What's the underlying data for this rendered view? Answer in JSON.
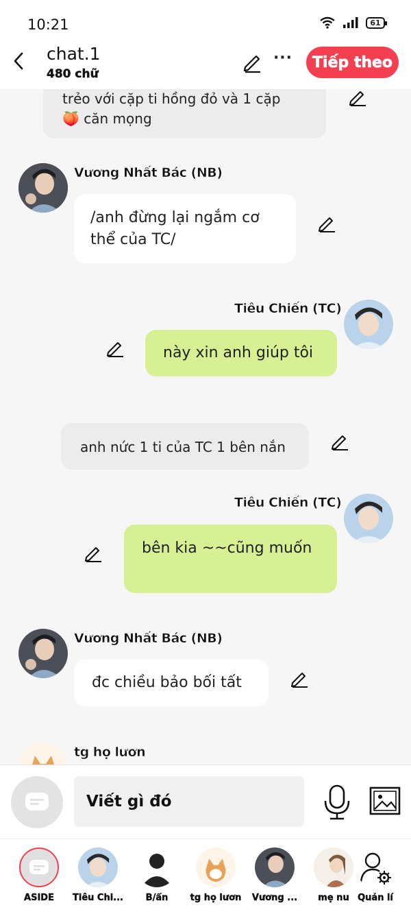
{
  "status": {
    "time": "10:21",
    "battery": "61"
  },
  "header": {
    "title": "chat.1",
    "subtitle": "480 chữ",
    "next_label": "Tiếp theo"
  },
  "messages": [
    {
      "text_line1": "trẻo với cặp ti hồng đỏ và 1 cặp",
      "text_line2": "căn mọng",
      "emoji": "🍑"
    },
    {
      "sender": "Vương Nhất Bác (NB)",
      "text": "/anh đừng lại ngắm cơ thể của TC/"
    },
    {
      "sender": "Tiêu Chiến (TC)",
      "text": "này xin anh giúp tôi"
    },
    {
      "text": "anh nức 1 ti của TC 1 bên nắn"
    },
    {
      "sender": "Tiêu Chiến (TC)",
      "text": "bên kia ~~cũng muốn"
    },
    {
      "sender": "Vương Nhất Bác (NB)",
      "text": "đc chiều bảo bối tất"
    },
    {
      "sender": "tg họ lươn"
    }
  ],
  "input": {
    "placeholder": "Viết gì đó"
  },
  "bottom": {
    "items": [
      {
        "label": "ASIDE"
      },
      {
        "label": "Tiêu Chi..."
      },
      {
        "label": "B/ẩn"
      },
      {
        "label": "tg họ lươn"
      },
      {
        "label": "Vương ..."
      },
      {
        "label": "mẹ nu"
      },
      {
        "label": "Quản lí"
      }
    ]
  },
  "colors": {
    "accent": "#f33f4f",
    "user_bubble": "#d7f093",
    "other_bubble": "#ffffff",
    "narration": "#ececec"
  }
}
